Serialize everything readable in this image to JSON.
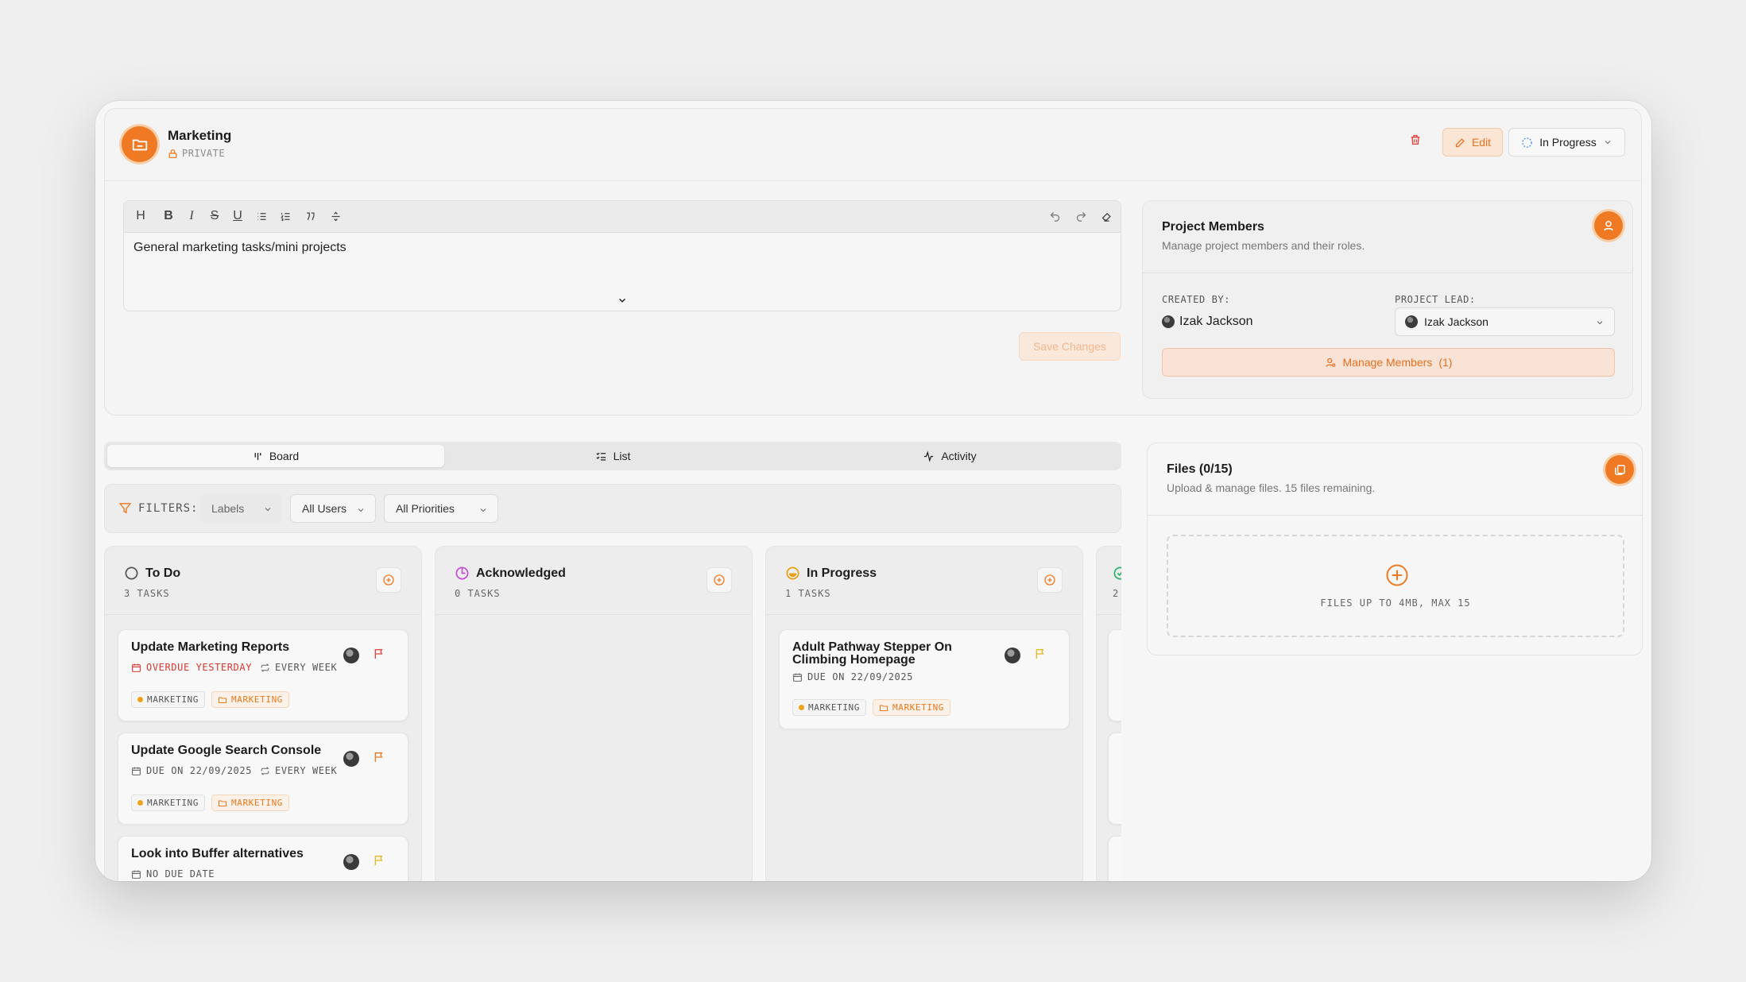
{
  "project": {
    "name": "Marketing",
    "visibility": "PRIVATE",
    "edit_label": "Edit",
    "status": "In Progress"
  },
  "editor": {
    "content": "General marketing tasks/mini projects",
    "toolbar": [
      "H",
      "B",
      "I",
      "S",
      "U"
    ],
    "save_label": "Save Changes"
  },
  "members": {
    "title": "Project Members",
    "subtitle": "Manage project members and their roles.",
    "created_by_label": "CREATED BY:",
    "created_by": "Izak Jackson",
    "lead_label": "PROJECT LEAD:",
    "lead": "Izak Jackson",
    "manage_label": "Manage Members",
    "manage_count": "(1)"
  },
  "tabs": [
    {
      "label": "Board",
      "active": true
    },
    {
      "label": "List",
      "active": false
    },
    {
      "label": "Activity",
      "active": false
    }
  ],
  "filters": {
    "label": "FILTERS:",
    "labels": "Labels",
    "users": "All Users",
    "priorities": "All Priorities"
  },
  "columns": [
    {
      "title": "To Do",
      "count": "3 TASKS",
      "tasks": [
        {
          "title": "Update Marketing Reports",
          "due": "OVERDUE YESTERDAY",
          "overdue": true,
          "repeat": "EVERY WEEK",
          "flag_color": "#d94a3b",
          "label": "MARKETING",
          "project": "MARKETING"
        },
        {
          "title": "Update Google Search Console",
          "due": "DUE ON 22/09/2025",
          "overdue": false,
          "repeat": "EVERY WEEK",
          "flag_color": "#ea7a24",
          "label": "MARKETING",
          "project": "MARKETING"
        },
        {
          "title": "Look into Buffer alternatives",
          "due": "NO DUE DATE",
          "overdue": false,
          "repeat": "",
          "flag_color": "#e6b81c",
          "label": "",
          "project": ""
        }
      ]
    },
    {
      "title": "Acknowledged",
      "count": "0 TASKS",
      "tasks": []
    },
    {
      "title": "In Progress",
      "count": "1 TASKS",
      "tasks": [
        {
          "title": "Adult Pathway Stepper On Climbing Homepage",
          "due": "DUE ON 22/09/2025",
          "overdue": false,
          "repeat": "",
          "flag_color": "#e6b81c",
          "label": "MARKETING",
          "project": "MARKETING"
        }
      ]
    },
    {
      "title": "",
      "count": "2",
      "tasks": []
    }
  ],
  "files": {
    "title": "Files (0/15)",
    "subtitle": "Upload & manage files. 15 files remaining.",
    "dropzone_text": "FILES UP TO 4MB, MAX 15"
  },
  "colors": {
    "accent": "#ef7a23",
    "overdue": "#d7372f",
    "acknowledged": "#c14fd2",
    "in_progress": "#e6a11c",
    "done": "#2bb36b"
  }
}
